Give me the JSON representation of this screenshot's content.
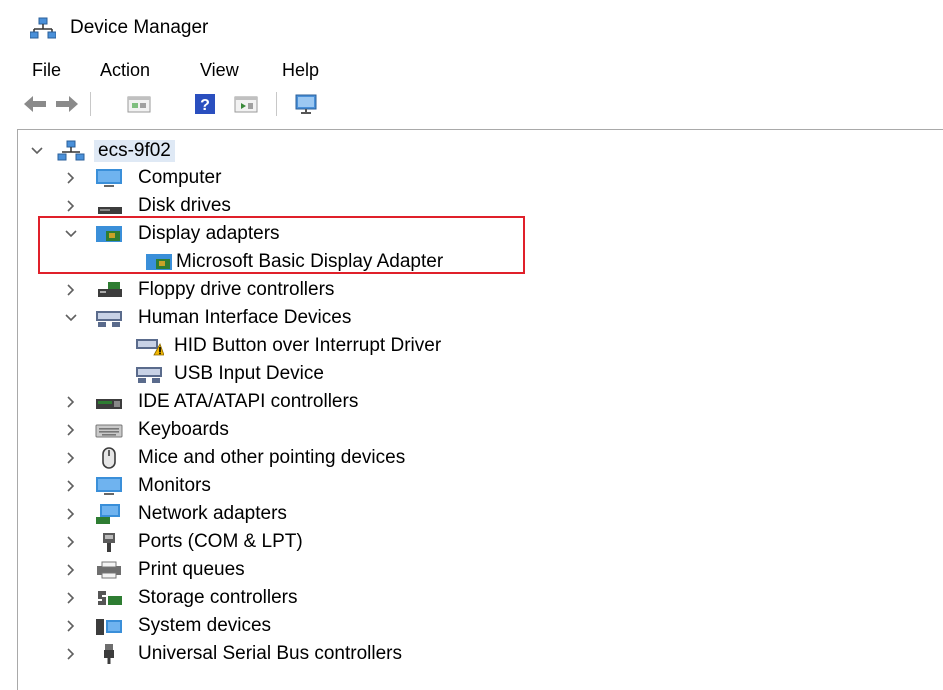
{
  "window": {
    "title": "Device Manager",
    "icon": "computer-network-icon"
  },
  "menu": [
    "File",
    "Action",
    "View",
    "Help"
  ],
  "toolbar": {
    "buttons": [
      "back-arrow-icon",
      "forward-arrow-icon",
      "properties-icon",
      "help-icon",
      "update-driver-icon",
      "scan-hardware-icon"
    ]
  },
  "tree": {
    "root": {
      "label": "ecs-9f02",
      "expanded": true
    },
    "items": [
      {
        "label": "Computer",
        "expanded": false,
        "icon": "computer-icon"
      },
      {
        "label": "Disk drives",
        "expanded": false,
        "icon": "disk-drive-icon"
      },
      {
        "label": "Display adapters",
        "expanded": true,
        "icon": "display-adapter-icon",
        "children": [
          {
            "label": "Microsoft Basic Display Adapter",
            "icon": "display-adapter-icon"
          }
        ]
      },
      {
        "label": "Floppy drive controllers",
        "expanded": false,
        "icon": "floppy-controller-icon"
      },
      {
        "label": "Human Interface Devices",
        "expanded": true,
        "icon": "hid-icon",
        "children": [
          {
            "label": "HID Button over Interrupt Driver",
            "icon": "hid-warning-icon"
          },
          {
            "label": "USB Input Device",
            "icon": "hid-icon"
          }
        ]
      },
      {
        "label": "IDE ATA/ATAPI controllers",
        "expanded": false,
        "icon": "ide-controller-icon"
      },
      {
        "label": "Keyboards",
        "expanded": false,
        "icon": "keyboard-icon"
      },
      {
        "label": "Mice and other pointing devices",
        "expanded": false,
        "icon": "mouse-icon"
      },
      {
        "label": "Monitors",
        "expanded": false,
        "icon": "monitor-icon"
      },
      {
        "label": "Network adapters",
        "expanded": false,
        "icon": "network-adapter-icon"
      },
      {
        "label": "Ports (COM & LPT)",
        "expanded": false,
        "icon": "port-icon"
      },
      {
        "label": "Print queues",
        "expanded": false,
        "icon": "printer-icon"
      },
      {
        "label": "Storage controllers",
        "expanded": false,
        "icon": "storage-controller-icon"
      },
      {
        "label": "System devices",
        "expanded": false,
        "icon": "system-devices-icon"
      },
      {
        "label": "Universal Serial Bus controllers",
        "expanded": false,
        "icon": "usb-icon"
      }
    ]
  },
  "colors": {
    "highlight_box": "#e0202a",
    "selection": "#dfe9f5",
    "chevron": "#606060"
  }
}
